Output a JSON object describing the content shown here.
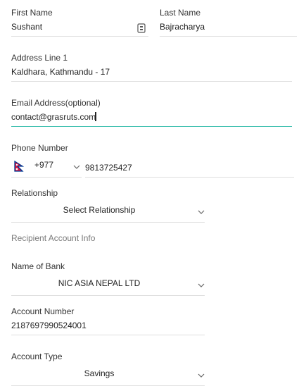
{
  "form": {
    "first_name": {
      "label": "First Name",
      "value": "Sushant"
    },
    "last_name": {
      "label": "Last Name",
      "value": "Bajracharya"
    },
    "address_line1": {
      "label": "Address Line 1",
      "value": "Kaldhara, Kathmandu - 17"
    },
    "email": {
      "label": "Email Address(optional)",
      "value": "contact@grasruts.com"
    },
    "phone": {
      "label": "Phone Number",
      "country_code": "+977",
      "value": "9813725427"
    },
    "relationship": {
      "label": "Relationship",
      "value": "Select Relationship"
    },
    "recipient_section": "Recipient Account Info",
    "bank": {
      "label": "Name of Bank",
      "value": "NIC ASIA NEPAL LTD"
    },
    "account_number": {
      "label": "Account Number",
      "value": "2187697990524001"
    },
    "account_type": {
      "label": "Account Type",
      "value": "Savings"
    }
  },
  "colors": {
    "active_underline": "#3bbfae",
    "underline": "#dedede",
    "flag_red": "#dc143c",
    "flag_blue": "#003893"
  },
  "icons": {
    "first_name_field": "contact-card-icon",
    "phone_country": "nepal-flag-icon",
    "dropdown": "chevron-down-icon"
  }
}
